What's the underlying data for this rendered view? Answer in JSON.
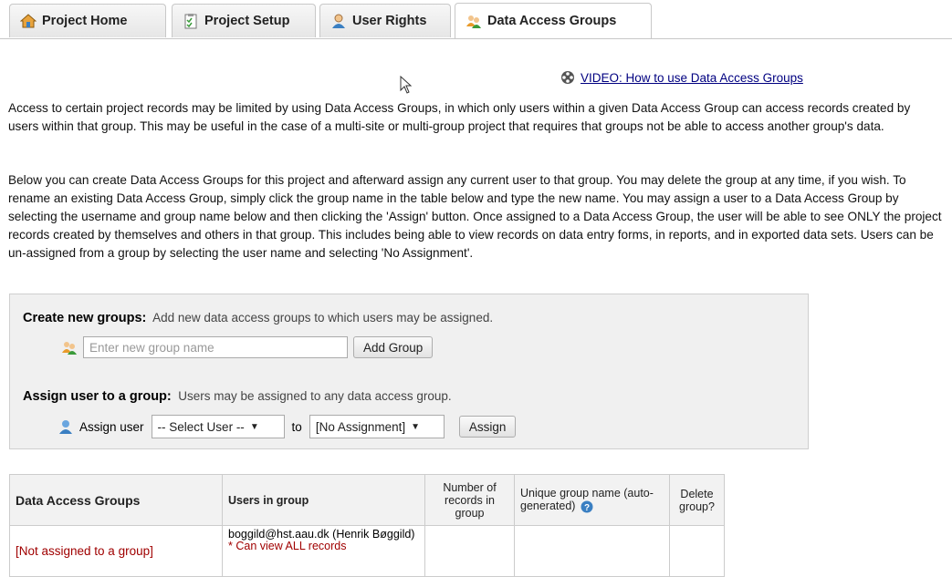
{
  "tabs": [
    {
      "label": "Project Home",
      "icon": "house-icon"
    },
    {
      "label": "Project Setup",
      "icon": "checklist-icon"
    },
    {
      "label": "User Rights",
      "icon": "user-icon"
    },
    {
      "label": "Data Access Groups",
      "icon": "group-icon",
      "active": true
    }
  ],
  "video_link": "VIDEO: How to use Data Access Groups",
  "intro_paragraph": "Access to certain project records may be limited by using Data Access Groups, in which only users within a given Data Access Group can access records created by users within that group. This may be useful in the case of a multi-site or multi-group project that requires that groups not be able to access another group's data.",
  "detail_paragraph": "Below you can create Data Access Groups for this project and afterward assign any current user to that group. You may delete the group at any time, if you wish. To rename an existing Data Access Group, simply click the group name in the table below and type the new name. You may assign a user to a Data Access Group by selecting the username and group name below and then clicking the 'Assign' button. Once assigned to a Data Access Group, the user will be able to see ONLY the project records created by themselves and others in that group. This includes being able to view records on data entry forms, in reports, and in exported data sets. Users can be un-assigned from a group by selecting the user name and selecting 'No Assignment'.",
  "create": {
    "heading": "Create new groups:",
    "description": "Add new data access groups to which users may be assigned.",
    "input_placeholder": "Enter new group name",
    "input_value": "",
    "button": "Add Group"
  },
  "assign": {
    "heading": "Assign user to a group:",
    "description": "Users may be assigned to any data access group.",
    "label": "Assign user",
    "user_select": "-- Select User --",
    "to_label": "to",
    "group_select": "[No Assignment]",
    "button": "Assign"
  },
  "table": {
    "headers": [
      "Data Access Groups",
      "Users in group",
      "Number of records in group",
      "Unique group name (auto-generated)",
      "Delete group?"
    ],
    "rows": [
      {
        "group": "[Not assigned to a group]",
        "users": "boggild@hst.aau.dk (Henrik Bøggild)",
        "note": "* Can view ALL records",
        "records": "",
        "unique_name": "",
        "delete": ""
      }
    ]
  },
  "colors": {
    "accent_red": "#a00000",
    "link": "#000080",
    "panel_bg": "#f0f0f0"
  }
}
